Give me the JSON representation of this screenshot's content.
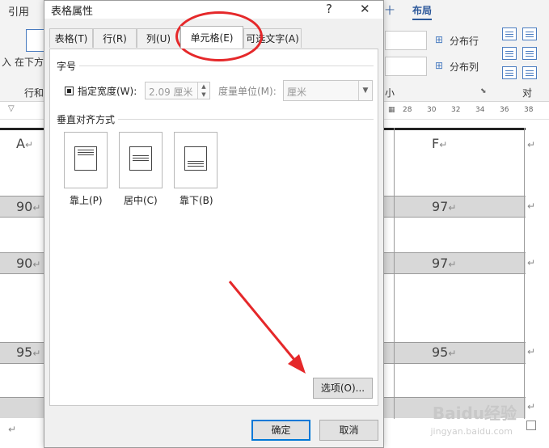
{
  "background": {
    "left_ribbon": {
      "tab_label": "引用",
      "group_label": "行和",
      "button_left": "入",
      "button_insert_below": "在下方"
    },
    "right_ribbon": {
      "tab_fragment": "十",
      "tab_layout": "布局",
      "distribute_rows": "分布行",
      "distribute_cols": "分布列",
      "group_fragment": "小",
      "group_fragment_right": "对"
    },
    "ruler_marks": [
      "28",
      "30",
      "32",
      "34",
      "36",
      "38"
    ],
    "table": {
      "header_left": "A",
      "header_right": "F",
      "rows": [
        {
          "left": "90",
          "right": "97"
        },
        {
          "left": "90",
          "right": "97"
        },
        {
          "left": "95",
          "right": "95"
        }
      ],
      "paragraph_mark": "↵"
    }
  },
  "dialog": {
    "title": "表格属性",
    "help_btn": "?",
    "close_btn": "✕",
    "tabs": [
      {
        "label": "表格(T)",
        "active": false
      },
      {
        "label": "行(R)",
        "active": false
      },
      {
        "label": "列(U)",
        "active": false
      },
      {
        "label": "单元格(E)",
        "active": true
      },
      {
        "label": "可选文字(A)",
        "active": false
      }
    ],
    "size_section": {
      "label": "字号",
      "specify_width_label": "指定宽度(W):",
      "width_value": "2.09 厘米",
      "unit_label": "度量单位(M):",
      "unit_value": "厘米"
    },
    "vertical_section": {
      "label": "垂直对齐方式",
      "options": [
        {
          "label": "靠上(P)"
        },
        {
          "label": "居中(C)"
        },
        {
          "label": "靠下(B)"
        }
      ]
    },
    "options_button": "选项(O)...",
    "ok_button": "确定",
    "cancel_button": "取消"
  },
  "watermark": {
    "brand": "Baidu经验",
    "site": "jingyan.baidu.com"
  },
  "colors": {
    "annotation_red": "#e5282a",
    "accent_blue": "#0078d7",
    "row_shade": "#d8d8d8"
  }
}
